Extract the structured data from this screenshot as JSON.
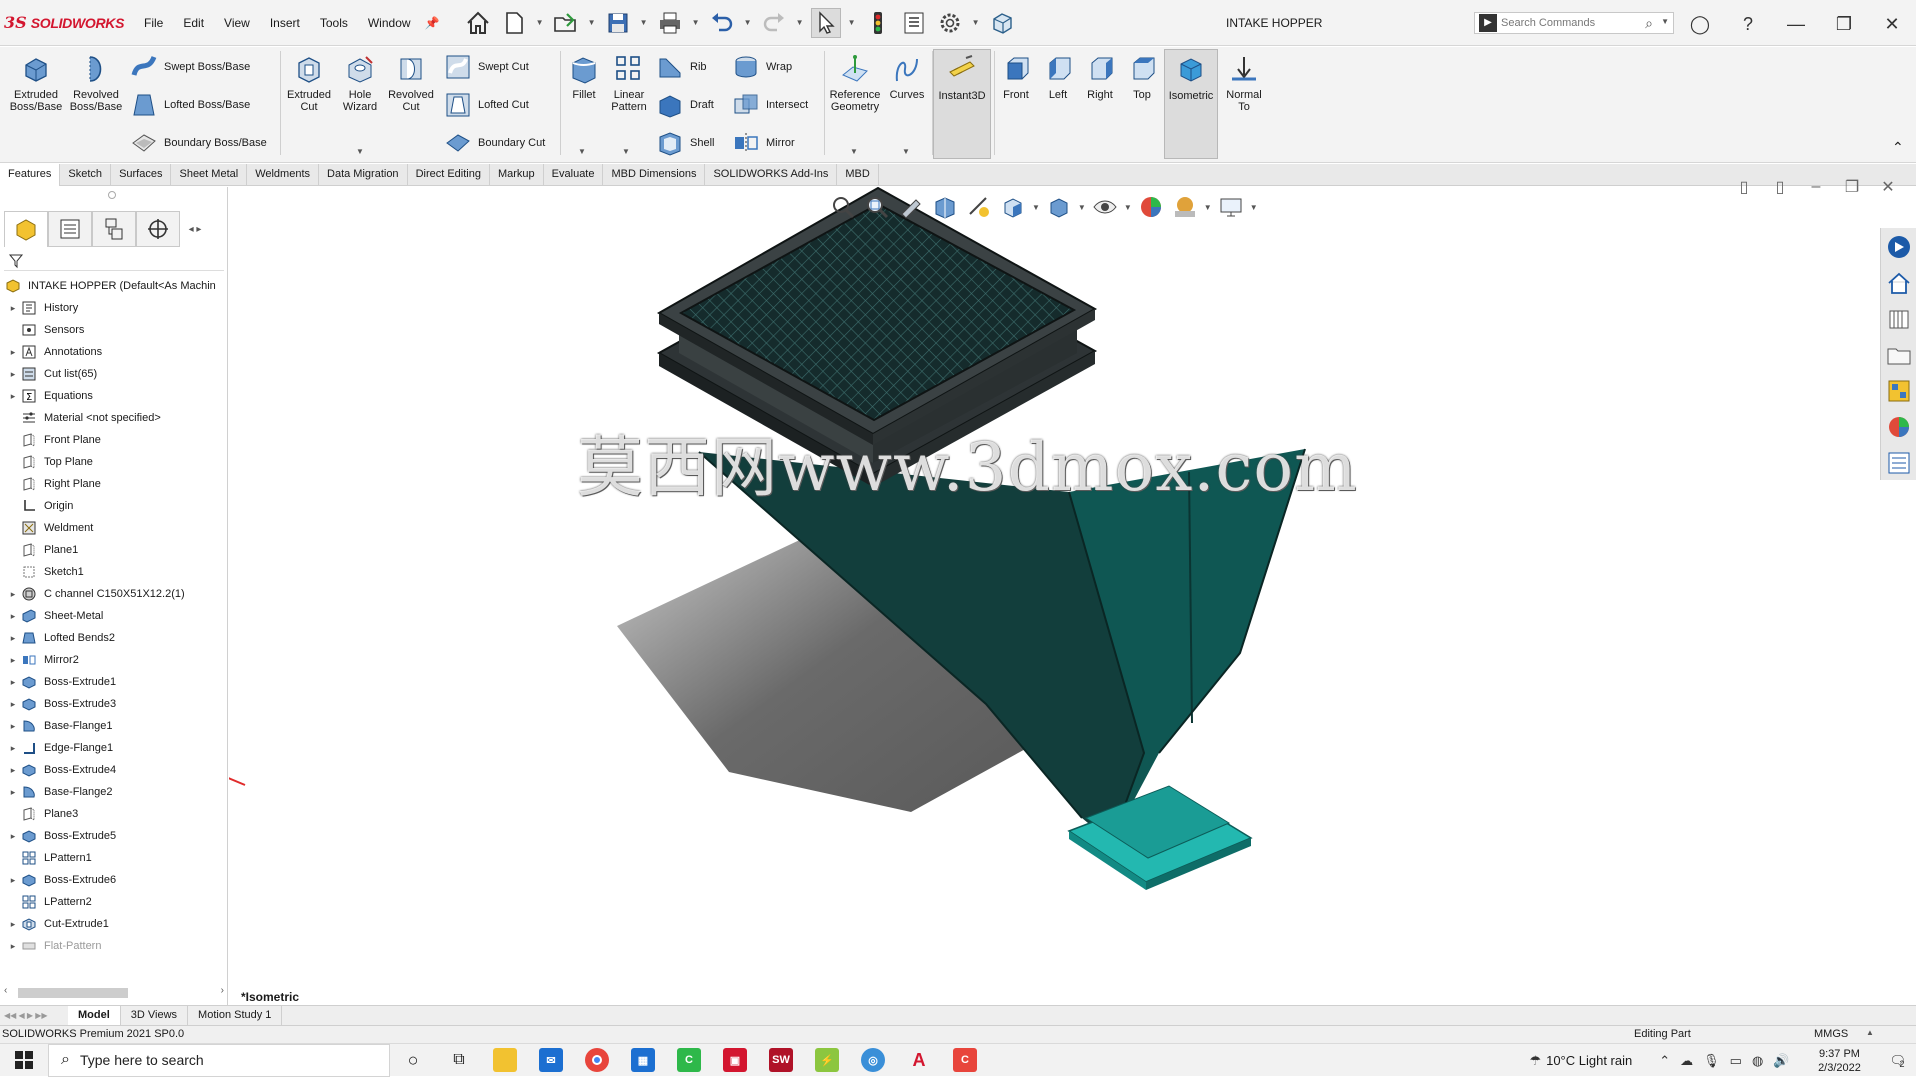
{
  "app": {
    "brand_prefix": "3S",
    "brand_name": "SOLIDWORKS",
    "document_title": "INTAKE HOPPER",
    "menus": [
      "File",
      "Edit",
      "View",
      "Insert",
      "Tools",
      "Window"
    ],
    "search_placeholder": "Search Commands"
  },
  "ribbon": {
    "extruded_boss": "Extruded Boss/Base",
    "revolved_boss": "Revolved Boss/Base",
    "swept_boss": "Swept Boss/Base",
    "lofted_boss": "Lofted Boss/Base",
    "boundary_boss": "Boundary Boss/Base",
    "extruded_cut": "Extruded Cut",
    "hole_wizard": "Hole Wizard",
    "revolved_cut": "Revolved Cut",
    "swept_cut": "Swept Cut",
    "lofted_cut": "Lofted Cut",
    "boundary_cut": "Boundary Cut",
    "fillet": "Fillet",
    "linear_pattern": "Linear Pattern",
    "rib": "Rib",
    "draft": "Draft",
    "shell": "Shell",
    "wrap": "Wrap",
    "intersect": "Intersect",
    "mirror": "Mirror",
    "reference_geometry": "Reference Geometry",
    "curves": "Curves",
    "instant3d": "Instant3D",
    "front": "Front",
    "left": "Left",
    "right": "Right",
    "top": "Top",
    "isometric": "Isometric",
    "normal_to": "Normal To"
  },
  "tabs": [
    "Features",
    "Sketch",
    "Surfaces",
    "Sheet Metal",
    "Weldments",
    "Data Migration",
    "Direct Editing",
    "Markup",
    "Evaluate",
    "MBD Dimensions",
    "SOLIDWORKS Add-Ins",
    "MBD"
  ],
  "tree": {
    "root": "INTAKE HOPPER  (Default<As Machin",
    "items": [
      {
        "label": "History",
        "icon": "history-icon",
        "expandable": true
      },
      {
        "label": "Sensors",
        "icon": "sensors-icon",
        "expandable": false
      },
      {
        "label": "Annotations",
        "icon": "annotations-icon",
        "expandable": true
      },
      {
        "label": "Cut list(65)",
        "icon": "cut-list-icon",
        "expandable": true
      },
      {
        "label": "Equations",
        "icon": "equations-icon",
        "expandable": true
      },
      {
        "label": "Material <not specified>",
        "icon": "material-icon",
        "expandable": false
      },
      {
        "label": "Front Plane",
        "icon": "plane-icon",
        "expandable": false
      },
      {
        "label": "Top Plane",
        "icon": "plane-icon",
        "expandable": false
      },
      {
        "label": "Right Plane",
        "icon": "plane-icon",
        "expandable": false
      },
      {
        "label": "Origin",
        "icon": "origin-icon",
        "expandable": false
      },
      {
        "label": "Weldment",
        "icon": "weldment-icon",
        "expandable": false
      },
      {
        "label": "Plane1",
        "icon": "plane-icon",
        "expandable": false
      },
      {
        "label": "Sketch1",
        "icon": "sketch-icon",
        "expandable": false
      },
      {
        "label": "C channel C150X51X12.2(1)",
        "icon": "structural-member-icon",
        "expandable": true
      },
      {
        "label": "Sheet-Metal",
        "icon": "sheet-metal-icon",
        "expandable": true
      },
      {
        "label": "Lofted Bends2",
        "icon": "lofted-bends-icon",
        "expandable": true
      },
      {
        "label": "Mirror2",
        "icon": "mirror-icon",
        "expandable": true
      },
      {
        "label": "Boss-Extrude1",
        "icon": "extrude-icon",
        "expandable": true
      },
      {
        "label": "Boss-Extrude3",
        "icon": "extrude-icon",
        "expandable": true
      },
      {
        "label": "Base-Flange1",
        "icon": "base-flange-icon",
        "expandable": true
      },
      {
        "label": "Edge-Flange1",
        "icon": "edge-flange-icon",
        "expandable": true
      },
      {
        "label": "Boss-Extrude4",
        "icon": "extrude-icon",
        "expandable": true
      },
      {
        "label": "Base-Flange2",
        "icon": "base-flange-icon",
        "expandable": true
      },
      {
        "label": "Plane3",
        "icon": "plane-icon",
        "expandable": false
      },
      {
        "label": "Boss-Extrude5",
        "icon": "extrude-icon",
        "expandable": true
      },
      {
        "label": "LPattern1",
        "icon": "pattern-icon",
        "expandable": false
      },
      {
        "label": "Boss-Extrude6",
        "icon": "extrude-icon",
        "expandable": true
      },
      {
        "label": "LPattern2",
        "icon": "pattern-icon",
        "expandable": false
      },
      {
        "label": "Cut-Extrude1",
        "icon": "cut-extrude-icon",
        "expandable": true
      },
      {
        "label": "Flat-Pattern",
        "icon": "flat-pattern-icon",
        "expandable": true,
        "dim": true
      }
    ]
  },
  "graphics": {
    "view_label": "*Isometric",
    "watermark": "莫西网www.3dmox.com"
  },
  "bottom_tabs": [
    "Model",
    "3D Views",
    "Motion Study 1"
  ],
  "status": {
    "left": "SOLIDWORKS Premium 2021 SP0.0",
    "mode": "Editing Part",
    "units": "MMGS"
  },
  "taskbar": {
    "search_placeholder": "Type here to search",
    "weather": "10°C  Light rain",
    "time": "9:37 PM",
    "date": "2/3/2022",
    "notifications": "2"
  },
  "colors": {
    "brand_red": "#d3162f",
    "hopper_teal": "#0f4a46",
    "flange_cyan": "#23b8b0"
  }
}
